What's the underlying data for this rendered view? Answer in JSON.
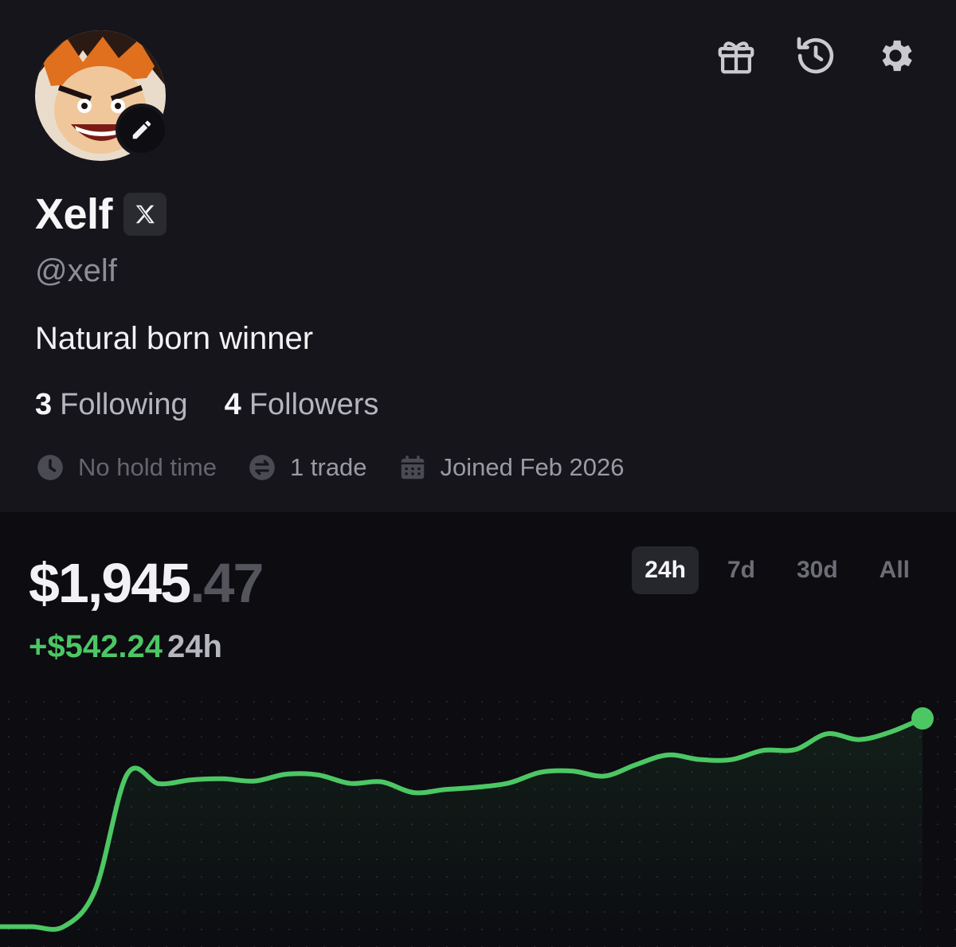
{
  "profile": {
    "display_name": "Xelf",
    "handle": "@xelf",
    "bio": "Natural born winner",
    "following_count": "3",
    "following_label": "Following",
    "followers_count": "4",
    "followers_label": "Followers",
    "meta": {
      "hold_time": "No hold time",
      "trades": "1 trade",
      "joined": "Joined Feb 2026"
    },
    "icons": [
      "gift-icon",
      "history-icon",
      "settings-icon",
      "edit-icon",
      "x-logo-icon",
      "clock-icon",
      "swap-icon",
      "calendar-icon"
    ]
  },
  "portfolio": {
    "balance_main": "$1,945",
    "balance_cents": ".47",
    "change_value": "+$542.24",
    "change_period": "24h",
    "ranges": [
      "24h",
      "7d",
      "30d",
      "All"
    ],
    "active_range": "24h"
  },
  "colors": {
    "background": "#15151b",
    "chart_background": "#0c0c11",
    "positive": "#4cc764",
    "muted": "#8d8d96"
  },
  "chart_data": {
    "type": "line",
    "title": "",
    "xlabel": "",
    "ylabel": "",
    "ylim": [
      1350,
      1970
    ],
    "grid": true,
    "series": [
      {
        "values": [
          1403,
          1403,
          1403,
          1500,
          1800,
          1775,
          1785,
          1788,
          1782,
          1800,
          1798,
          1776,
          1780,
          1752,
          1760,
          1766,
          1777,
          1805,
          1808,
          1795,
          1825,
          1850,
          1838,
          1838,
          1862,
          1864,
          1905,
          1890,
          1910,
          1945
        ]
      }
    ]
  }
}
